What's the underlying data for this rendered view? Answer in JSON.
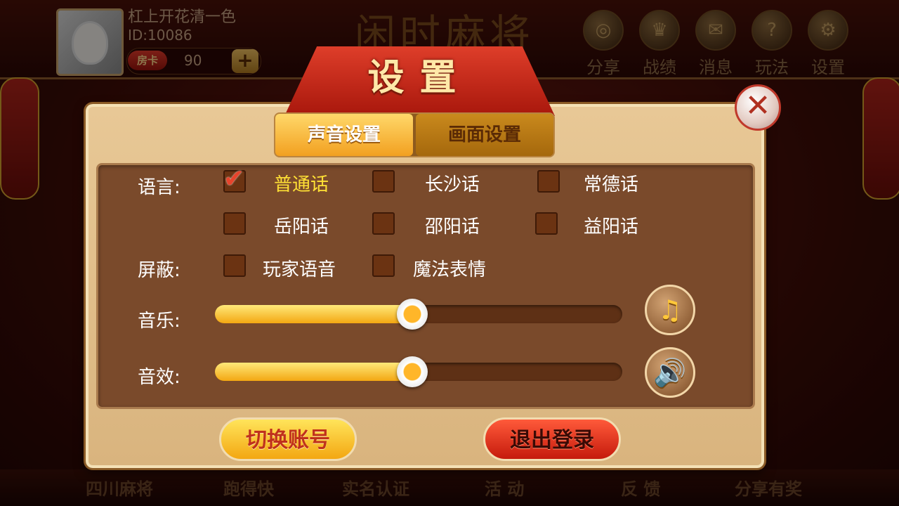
{
  "header": {
    "nickname": "杠上开花清一色",
    "user_id": "ID:10086",
    "room_card_label": "房卡",
    "room_card_count": "90",
    "add_label": "+",
    "logo_text": "闲时麻将",
    "buttons": [
      {
        "label": "分享",
        "icon": "share-icon",
        "glyph": "◎"
      },
      {
        "label": "战绩",
        "icon": "trophy-icon",
        "glyph": "♛"
      },
      {
        "label": "消息",
        "icon": "mail-icon",
        "glyph": "✉"
      },
      {
        "label": "玩法",
        "icon": "help-icon",
        "glyph": "?"
      },
      {
        "label": "设置",
        "icon": "gear-icon",
        "glyph": "⚙"
      }
    ]
  },
  "dialog": {
    "title": "设置",
    "close_glyph": "✕",
    "tabs": [
      {
        "label": "声音设置",
        "active": true
      },
      {
        "label": "画面设置",
        "active": false
      }
    ],
    "language_label": "语言:",
    "languages": [
      {
        "label": "普通话",
        "checked": true
      },
      {
        "label": "长沙话",
        "checked": false
      },
      {
        "label": "常德话",
        "checked": false
      },
      {
        "label": "岳阳话",
        "checked": false
      },
      {
        "label": "邵阳话",
        "checked": false
      },
      {
        "label": "益阳话",
        "checked": false
      }
    ],
    "block_label": "屏蔽:",
    "block_options": [
      {
        "label": "玩家语音",
        "checked": false
      },
      {
        "label": "魔法表情",
        "checked": false
      }
    ],
    "music_label": "音乐:",
    "music_level": 0.45,
    "music_icon": "music-note-icon",
    "music_glyph": "♫",
    "sfx_label": "音效:",
    "sfx_level": 0.45,
    "sfx_icon": "speaker-icon",
    "sfx_glyph": "🔊",
    "switch_account_label": "切换账号",
    "logout_label": "退出登录"
  },
  "bottom_nav": [
    "四川麻将",
    "跑得快",
    "实名认证",
    "活 动",
    "反 馈",
    "分享有奖"
  ],
  "colors": {
    "accent_yellow": "#f3a712",
    "accent_red": "#c51a0c",
    "panel_brown": "#7a4a2b",
    "selected_text": "#ffe135"
  }
}
